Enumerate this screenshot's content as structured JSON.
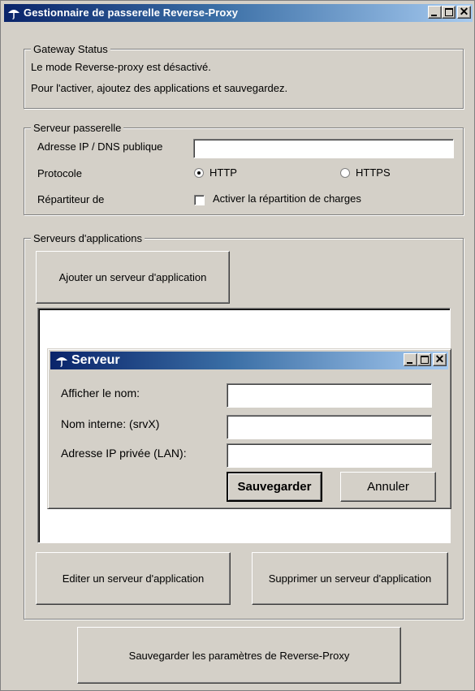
{
  "window": {
    "title": "Gestionnaire de passerelle Reverse-Proxy"
  },
  "gateway_status": {
    "legend": "Gateway Status",
    "line1": "Le mode Reverse-proxy est désactivé.",
    "line2": "Pour l'activer, ajoutez des applications et sauvegardez."
  },
  "serveur_passerelle": {
    "legend": "Serveur passerelle",
    "ip_label": "Adresse IP / DNS publique",
    "ip_value": "",
    "protocol_label": "Protocole",
    "protocol_options": [
      "HTTP",
      "HTTPS"
    ],
    "protocol_selected": "HTTP",
    "repartiteur_label": "Répartiteur de",
    "load_balancing_label": "Activer la répartition de charges",
    "load_balancing_checked": false
  },
  "serveurs_applications": {
    "legend": "Serveurs d'applications",
    "add_button": "Ajouter un serveur d'application",
    "edit_button": "Editer un serveur d'application",
    "delete_button": "Supprimer un serveur d'application"
  },
  "serveur_dialog": {
    "title": "Serveur",
    "display_name_label": "Afficher le nom:",
    "internal_name_label": "Nom interne: (srvX)",
    "private_ip_label": "Adresse IP privée (LAN):",
    "display_name_value": "",
    "internal_name_value": "",
    "private_ip_value": "",
    "save_button": "Sauvegarder",
    "cancel_button": "Annuler"
  },
  "save_settings_button": "Sauvegarder les paramètres de Reverse-Proxy",
  "icons": {
    "app_icon": "umbrella-icon",
    "minimize": "minimize-icon",
    "maximize": "maximize-icon",
    "close": "close-icon"
  },
  "colors": {
    "title_bar_start": "#0a246a",
    "title_bar_end": "#a6caf0",
    "window_bg": "#d4d0c8"
  }
}
